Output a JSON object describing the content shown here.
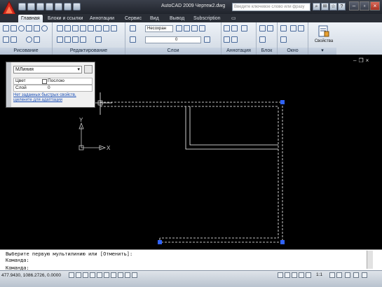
{
  "title_bar": {
    "app_title": "AutoCAD 2009 Чертеж2.dwg",
    "search_placeholder": "Введите ключевое слово или фразу"
  },
  "tabs": [
    "Главная",
    "Блоки и ссылки",
    "Аннотации",
    "Сервис",
    "Вид",
    "Вывод",
    "Subscription"
  ],
  "ribbon": {
    "panels": [
      "Рисование",
      "Редактирование",
      "Слои",
      "Аннотация",
      "Блок",
      "Окно"
    ],
    "layer_state_combo": "Несохран",
    "layer_combo": "0",
    "properties_button": "Свойства"
  },
  "quick_properties": {
    "object_type": "МЛиния",
    "rows": [
      {
        "label": "Цвет",
        "value": "Послою"
      },
      {
        "label": "Слой",
        "value": "0"
      }
    ],
    "link": "Нет заданных быстрых свойств, щелкните для адаптации"
  },
  "ucs": {
    "x_label": "X",
    "y_label": "Y"
  },
  "command_line": {
    "lines": [
      "Выберите первую мультилинию или [Отменить]:",
      "Команда:",
      "Команда:"
    ]
  },
  "status_bar": {
    "coordinates": "477.9430, 1086.2726, 0.0000",
    "scale": "1:1"
  },
  "colors": {
    "canvas": "#000000",
    "grip": "#2f63ff",
    "selection": "#ffffff",
    "accent": "#e03020"
  }
}
